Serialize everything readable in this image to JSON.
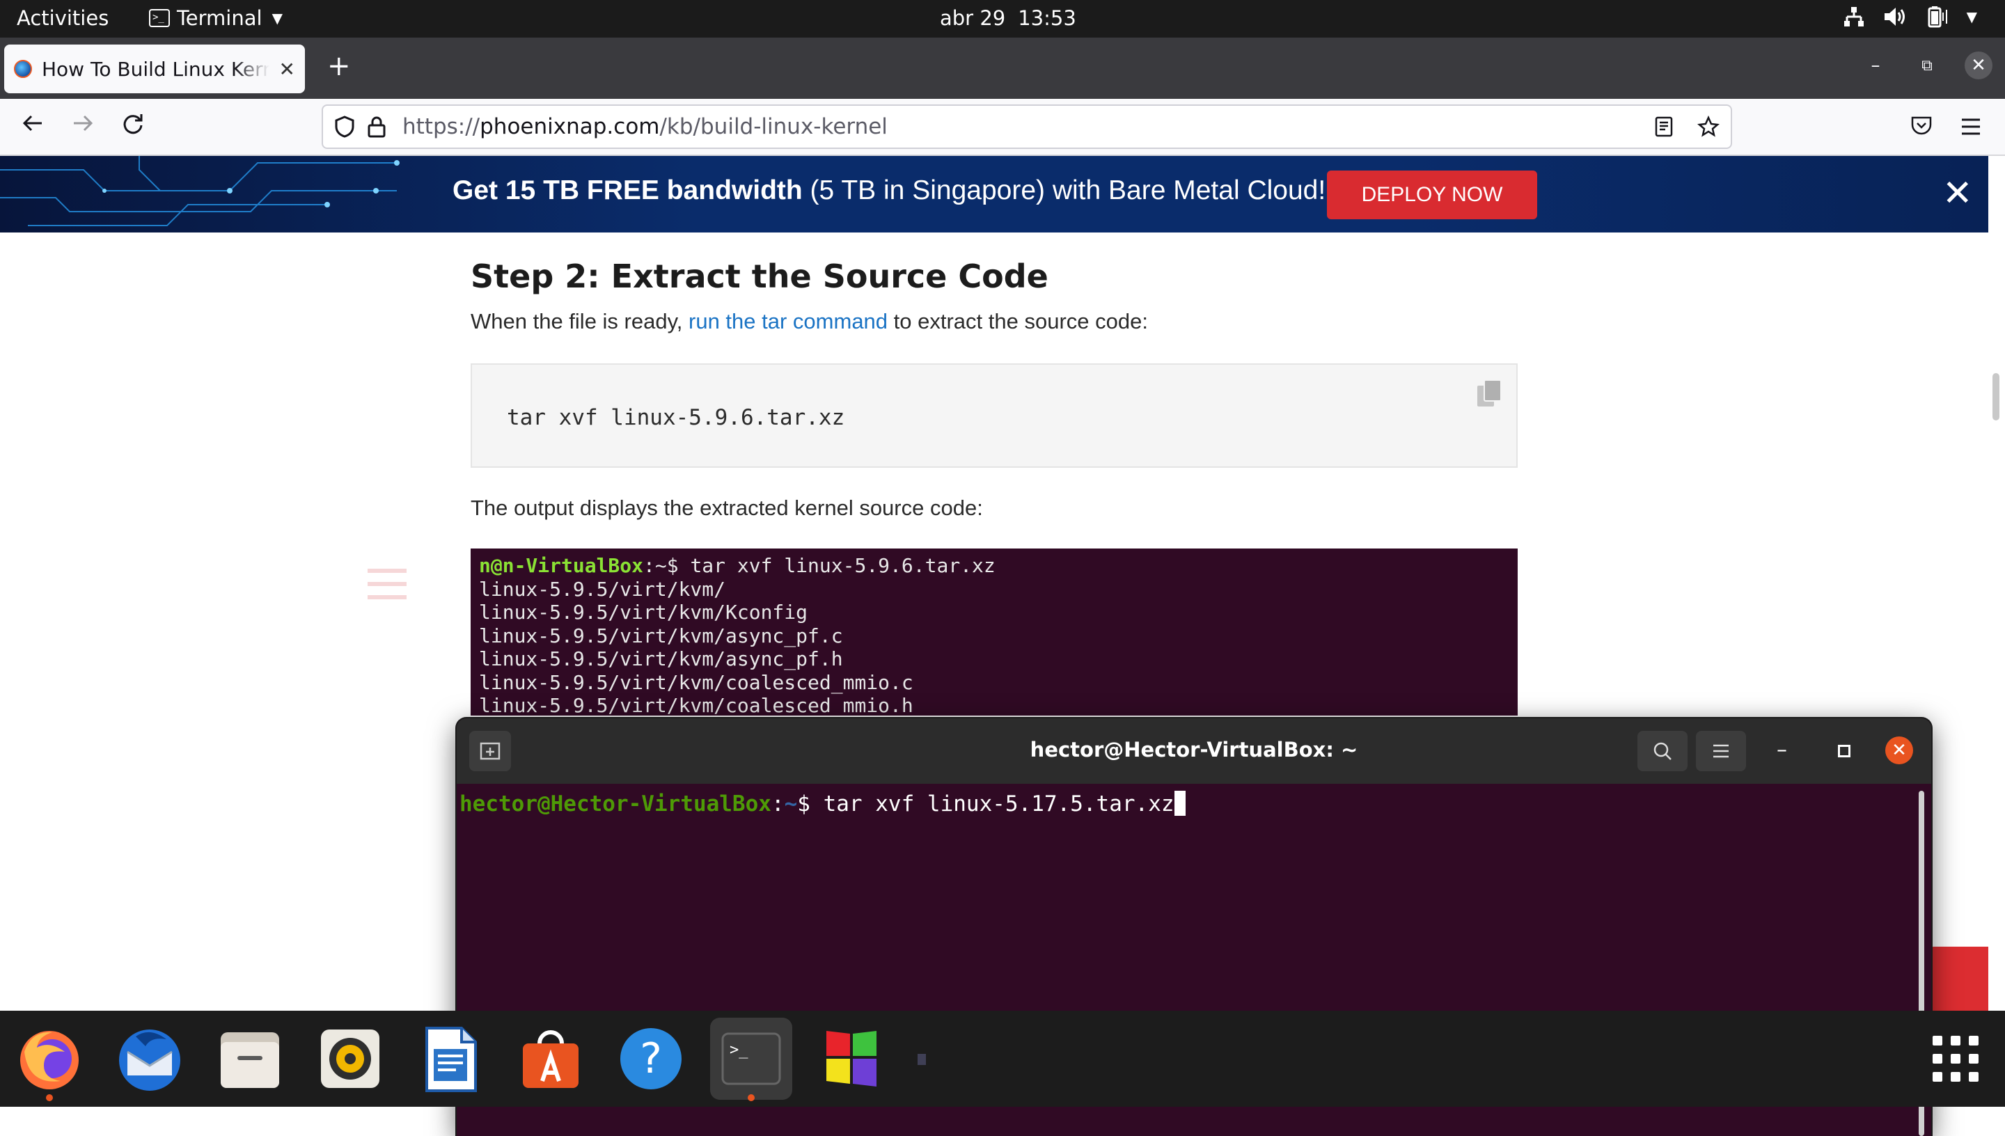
{
  "topbar": {
    "activities": "Activities",
    "app_name": "Terminal",
    "date": "abr 29",
    "time": "13:53"
  },
  "browser": {
    "tab_title": "How To Build Linux Kernel",
    "url_scheme": "https://",
    "url_host": "phoenixnap.com",
    "url_path": "/kb/build-linux-kernel"
  },
  "banner": {
    "promo_bold": "Get 15 TB FREE bandwidth",
    "promo_rest": " (5 TB in Singapore) with Bare Metal Cloud!",
    "cta": "DEPLOY NOW"
  },
  "article": {
    "heading": "Step 2: Extract the Source Code",
    "p1_before": "When the file is ready, ",
    "p1_link": "run the tar command",
    "p1_after": " to extract the source code:",
    "code": "tar xvf linux-5.9.6.tar.xz",
    "p2": "The output displays the extracted kernel source code:",
    "screenshot": {
      "prompt_user": "n@n-VirtualBox",
      "prompt_sep": ":~$ ",
      "command": "tar xvf linux-5.9.6.tar.xz",
      "lines": [
        "linux-5.9.5/virt/kvm/",
        "linux-5.9.5/virt/kvm/Kconfig",
        "linux-5.9.5/virt/kvm/async_pf.c",
        "linux-5.9.5/virt/kvm/async_pf.h",
        "linux-5.9.5/virt/kvm/coalesced_mmio.c",
        "linux-5.9.5/virt/kvm/coalesced_mmio.h"
      ]
    }
  },
  "terminal": {
    "title": "hector@Hector-VirtualBox: ~",
    "prompt_user": "hector@Hector-VirtualBox",
    "prompt_colon": ":",
    "prompt_path": "~",
    "prompt_dollar": "$ ",
    "command": "tar xvf linux-5.17.5.tar.xz"
  },
  "dock": {
    "apps": [
      "firefox-icon",
      "thunderbird-icon",
      "files-icon",
      "rhythmbox-icon",
      "writer-icon",
      "software-icon",
      "help-icon",
      "terminal-icon",
      "windows-app-icon"
    ]
  },
  "colors": {
    "terminal_bg": "#300a24",
    "ubuntu_orange": "#e95420",
    "deploy_red": "#d92b30",
    "link_blue": "#1a73c4"
  }
}
